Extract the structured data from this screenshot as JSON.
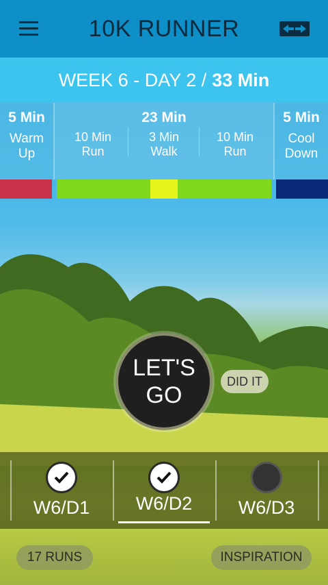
{
  "app": {
    "title": "10K RUNNER"
  },
  "week_header": {
    "prefix": "WEEK 6 - DAY 2 /",
    "total": "33 Min"
  },
  "segments": {
    "warmup": {
      "time": "5 Min",
      "label": "Warm Up"
    },
    "main": {
      "time": "23 Min",
      "parts": [
        {
          "time": "10 Min",
          "label": "Run"
        },
        {
          "time": "3 Min",
          "label": "Walk"
        },
        {
          "time": "10 Min",
          "label": "Run"
        }
      ]
    },
    "cooldown": {
      "time": "5 Min",
      "label": "Cool Down"
    }
  },
  "colors": {
    "warmup_bar": "#c8334a",
    "run_bar": "#7fd81c",
    "walk_bar": "#e8f51c",
    "cooldown_bar": "#0a2a78"
  },
  "go_button": {
    "line1": "LET'S",
    "line2": "GO"
  },
  "did_it_button": "DID IT",
  "days": [
    {
      "label": "W6/D1",
      "completed": true
    },
    {
      "label": "W6/D2",
      "completed": true,
      "selected": true
    },
    {
      "label": "W6/D3",
      "completed": false
    }
  ],
  "footer": {
    "runs": "17 RUNS",
    "inspiration": "INSPIRATION"
  }
}
